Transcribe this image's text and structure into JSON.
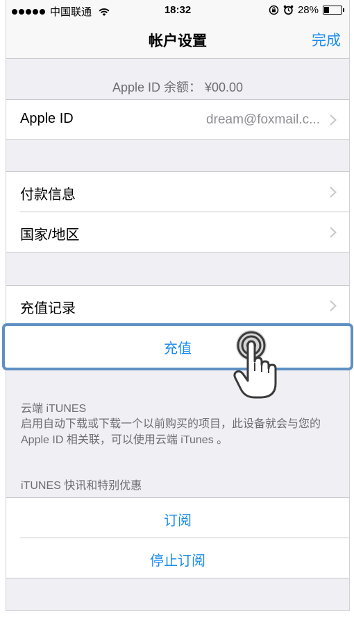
{
  "status_bar": {
    "carrier": "中国联通",
    "time": "18:32",
    "battery": "28%"
  },
  "nav": {
    "title": "帐户设置",
    "done_label": "完成"
  },
  "balance_text": "Apple ID 余额： ¥00.00",
  "apple_id": {
    "label": "Apple ID",
    "value": "dream@foxmail.c..."
  },
  "payment": {
    "label": "付款信息"
  },
  "region": {
    "label": "国家/地区"
  },
  "recharge_history": {
    "label": "充值记录"
  },
  "recharge": {
    "label": "充值"
  },
  "cloud": {
    "header": "云端 iTUNES",
    "description": "启用自动下载或下载一个以前购买的项目，此设备就会与您的 Apple ID 相关联，可以使用云端 iTunes 。"
  },
  "newsletter": {
    "header": "iTUNES 快讯和特别优惠",
    "subscribe_label": "订阅",
    "unsubscribe_label": "停止订阅"
  },
  "colors": {
    "accent": "#1a8bf0",
    "highlight_border": "#5f90c4",
    "background": "#efeff4"
  },
  "icons": {
    "wifi": "wifi-icon",
    "rotation_lock": "rotation-lock-icon",
    "alarm": "alarm-icon",
    "battery": "battery-icon",
    "chevron": "chevron-right-icon",
    "hand": "hand-tap-icon"
  },
  "battery_level": 0.28
}
